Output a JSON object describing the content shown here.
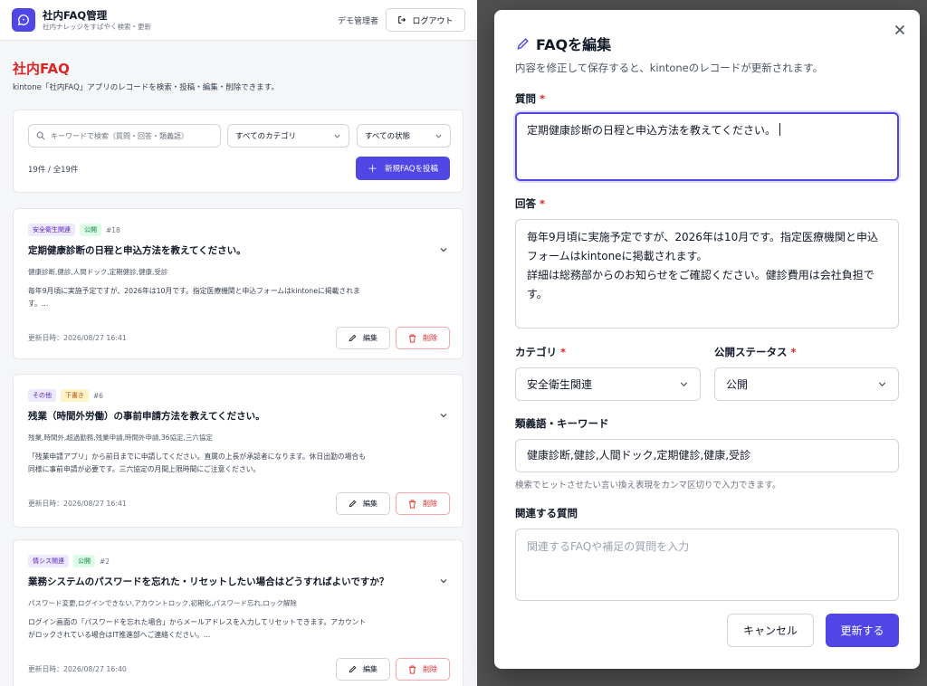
{
  "header": {
    "app_title": "社内FAQ管理",
    "app_subtitle": "社内ナレッジをすばやく検索・更新",
    "user_name": "デモ管理者",
    "logout_label": "ログアウト"
  },
  "page": {
    "title": "社内FAQ",
    "description": "kintone「社内FAQ」アプリのレコードを検索・投稿・編集・削除できます。"
  },
  "search": {
    "placeholder": "キーワードで検索（質問・回答・類義語）",
    "category_select": "すべてのカテゴリ",
    "status_select": "すべての状態",
    "count": "19件 / 全19件",
    "new_button": "新規FAQを投稿"
  },
  "faqs": [
    {
      "category": "安全衛生関連",
      "status": "公開",
      "id": "#18",
      "question": "定期健康診断の日程と申込方法を教えてください。",
      "keywords": "健康診断,健診,人間ドック,定期健診,健康,受診",
      "answer": "毎年9月頃に実施予定ですが、2026年は10月です。指定医療機関と申込フォームはkintoneに掲載されます。...",
      "updated": "更新日時：2026/08/27 16:41",
      "edit": "編集",
      "delete": "削除"
    },
    {
      "category": "その他",
      "status": "下書き",
      "id": "#6",
      "question": "残業（時間外労働）の事前申請方法を教えてください。",
      "keywords": "残業,時間外,超過勤務,残業申請,時間外申請,36協定,三六協定",
      "answer": "「残業申請アプリ」から前日までに申請してください。直属の上長が承認者になります。休日出勤の場合も同様に事前申請が必要です。三六協定の月間上限時間にご注意ください。",
      "updated": "更新日時：2026/08/27 16:41",
      "edit": "編集",
      "delete": "削除"
    },
    {
      "category": "情シス関連",
      "status": "公開",
      "id": "#2",
      "question": "業務システムのパスワードを忘れた・リセットしたい場合はどうすればよいですか？",
      "keywords": "パスワード変更,ログインできない,アカウントロック,初期化,パスワード忘れ,ロック解除",
      "answer": "ログイン画面の「パスワードを忘れた場合」からメールアドレスを入力してリセットできます。アカウントがロックされている場合はIT推進部へご連絡ください。...",
      "updated": "更新日時：2026/08/27 16:40",
      "edit": "編集",
      "delete": "削除"
    }
  ],
  "modal": {
    "title": "FAQを編集",
    "description": "内容を修正して保存すると、kintoneのレコードが更新されます。",
    "question_label": "質問",
    "question_value": "定期健康診断の日程と申込方法を教えてください。",
    "answer_label": "回答",
    "answer_line1": "毎年9月頃に実施予定ですが、2026年は10月です。指定医療機関と申込フォームはkintoneに掲載されます。",
    "answer_line2": "詳細は総務部からのお知らせをご確認ください。健診費用は会社負担です。",
    "category_label": "カテゴリ",
    "category_value": "安全衛生関連",
    "status_label": "公開ステータス",
    "status_value": "公開",
    "keywords_label": "類義語・キーワード",
    "keywords_value": "健康診断,健診,人間ドック,定期健診,健康,受診",
    "keywords_help": "検索でヒットさせたい言い換え表現をカンマ区切りで入力できます。",
    "related_label": "関連する質問",
    "related_placeholder": "関連するFAQや補足の質問を入力",
    "required_mark": "*",
    "cancel": "キャンセル",
    "submit": "更新する"
  },
  "colors": {
    "accent": "#4f46e5",
    "danger": "#dc2626"
  }
}
